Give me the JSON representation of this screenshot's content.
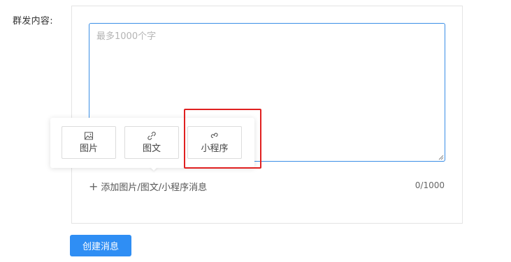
{
  "form": {
    "content_label": "群发内容:",
    "textarea": {
      "value": "",
      "placeholder": "最多1000个字"
    },
    "add_link": {
      "icon": "plus-icon",
      "label": "添加图片/图文/小程序消息"
    },
    "counter": "0/1000"
  },
  "popover": {
    "buttons": [
      {
        "label": "图片",
        "icon": "image-icon"
      },
      {
        "label": "图文",
        "icon": "link-icon"
      },
      {
        "label": "小程序",
        "icon": "mini-program-icon"
      }
    ]
  },
  "annotation": {
    "highlight_color": "#e02020",
    "highlighted_item": "小程序"
  },
  "actions": {
    "create_label": "创建消息"
  },
  "colors": {
    "primary": "#2f8ef4",
    "textarea_border": "#3a8ee6"
  }
}
